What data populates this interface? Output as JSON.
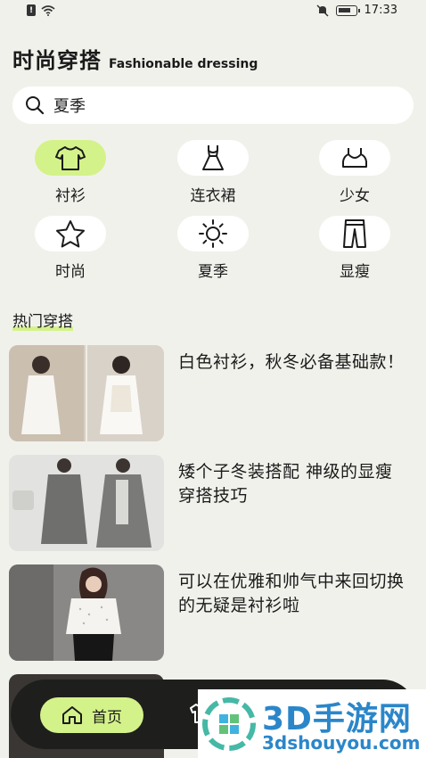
{
  "status_bar": {
    "time": "17:33",
    "sim_label": "!"
  },
  "header": {
    "title": "时尚穿搭",
    "subtitle": "Fashionable dressing"
  },
  "search": {
    "value": "夏季"
  },
  "categories": [
    {
      "label": "衬衫",
      "icon": "shirt-icon",
      "active": true
    },
    {
      "label": "连衣裙",
      "icon": "dress-icon",
      "active": false
    },
    {
      "label": "少女",
      "icon": "tank-top-icon",
      "active": false
    },
    {
      "label": "时尚",
      "icon": "star-icon",
      "active": false
    },
    {
      "label": "夏季",
      "icon": "sun-icon",
      "active": false
    },
    {
      "label": "显瘦",
      "icon": "pants-icon",
      "active": false
    }
  ],
  "section": {
    "title": "热门穿搭"
  },
  "articles": [
    {
      "title": "白色衬衫，秋冬必备基础款！"
    },
    {
      "title": "矮个子冬装搭配 神级的显瘦穿搭技巧"
    },
    {
      "title": "可以在优雅和帅气中来回切换的无疑是衬衫啦"
    }
  ],
  "bottom_nav": {
    "home_label": "首页"
  },
  "watermark": {
    "title": "3D手游网",
    "url": "3dshouyou.com"
  },
  "colors": {
    "accent": "#d4f28a",
    "background": "#f1f1ec",
    "nav_bg": "#1e1f1d",
    "watermark": "#2b86c9"
  }
}
